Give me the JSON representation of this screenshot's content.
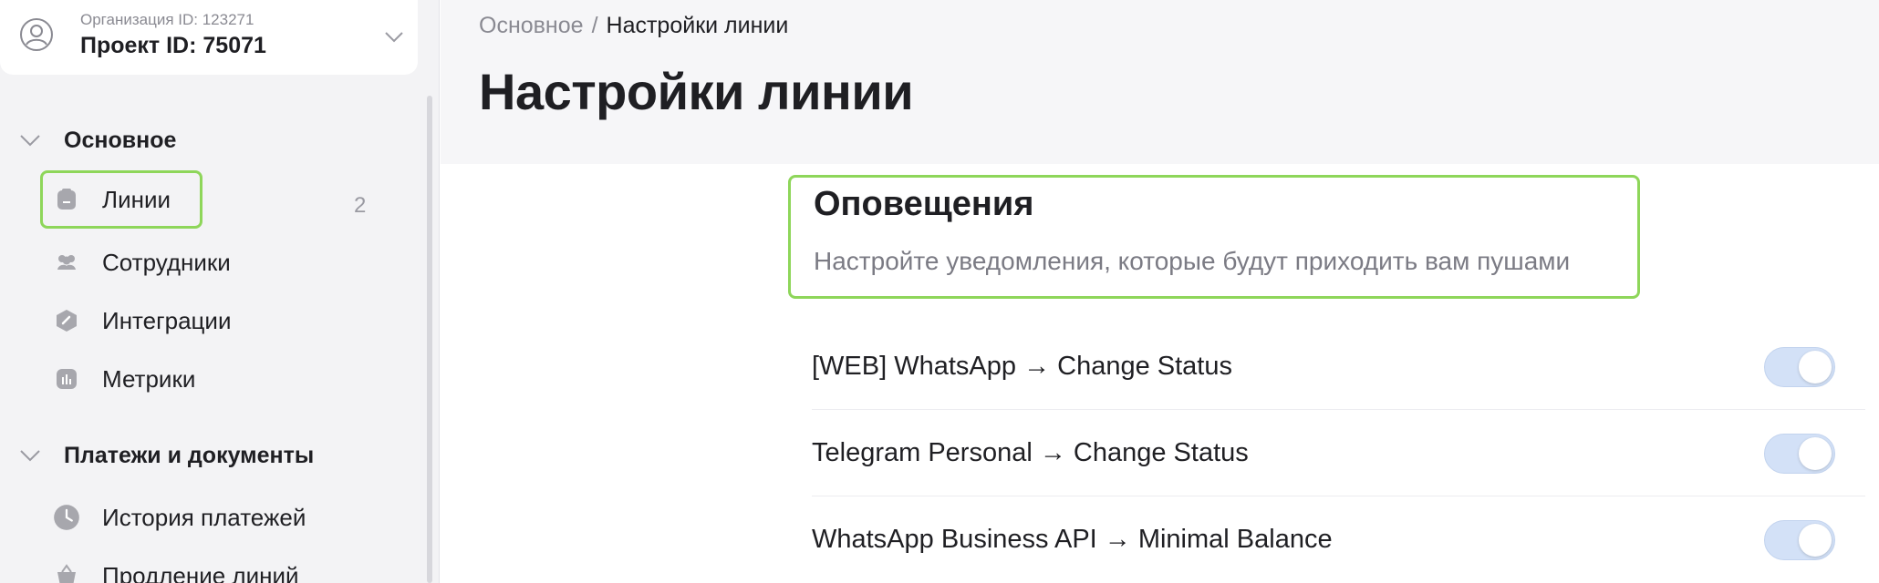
{
  "project": {
    "org_label": "Организация ID: 123271",
    "project_label": "Проект ID: 75071"
  },
  "sidebar": {
    "sections": [
      {
        "title": "Основное",
        "items": [
          {
            "label": "Линии",
            "icon": "clipboard-icon",
            "count": "2",
            "active": true
          },
          {
            "label": "Сотрудники",
            "icon": "users-icon"
          },
          {
            "label": "Интеграции",
            "icon": "integration-icon"
          },
          {
            "label": "Метрики",
            "icon": "chart-icon"
          }
        ]
      },
      {
        "title": "Платежи и документы",
        "items": [
          {
            "label": "История платежей",
            "icon": "clock-icon"
          },
          {
            "label": "Продление линий",
            "icon": "basket-icon"
          }
        ]
      }
    ]
  },
  "breadcrumb": {
    "root": "Основное",
    "separator": "/",
    "current": "Настройки линии"
  },
  "page": {
    "title": "Настройки линии"
  },
  "notifications": {
    "title": "Оповещения",
    "description": "Настройте уведомления, которые будут приходить вам пушами",
    "rows": [
      {
        "label": "[WEB] WhatsApp → Change Status",
        "enabled": true
      },
      {
        "label": "Telegram Personal → Change Status",
        "enabled": true
      },
      {
        "label": "WhatsApp Business API → Minimal Balance",
        "enabled": true
      }
    ]
  },
  "colors": {
    "highlight": "#8ed65a",
    "toggle_on": "#d3e1f7",
    "sidebar_bg": "#f3f3f5",
    "header_bg": "#f6f6f8"
  }
}
